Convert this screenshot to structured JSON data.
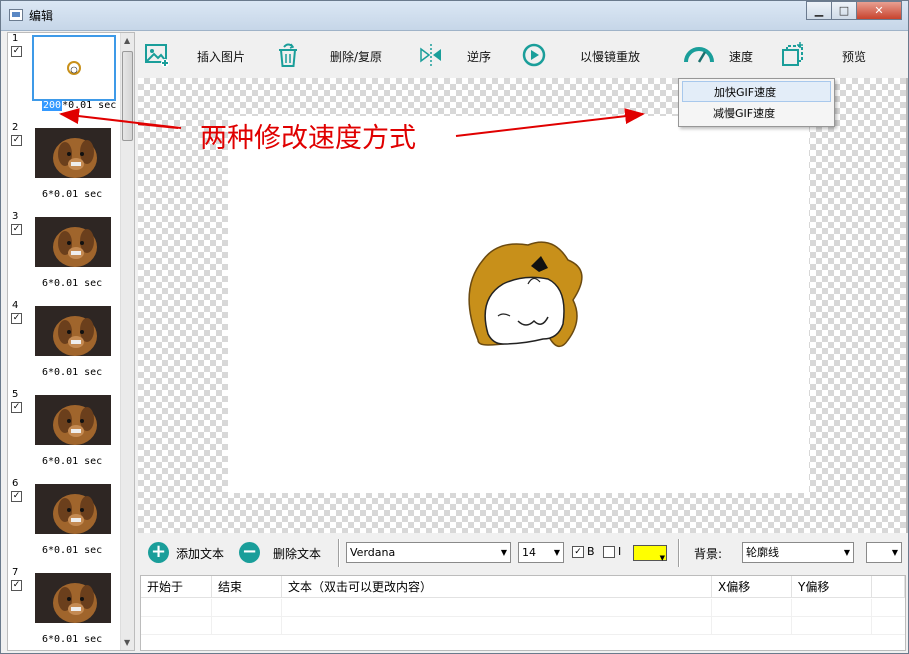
{
  "window": {
    "title": "编辑",
    "min_label": "▁",
    "max_label": "□",
    "close_label": "✕"
  },
  "frames": [
    {
      "index": "1",
      "checked": "✓",
      "delay_value": "200",
      "delay_suffix": "*0.01 sec"
    },
    {
      "index": "2",
      "checked": "✓",
      "delay_label": "6*0.01 sec"
    },
    {
      "index": "3",
      "checked": "✓",
      "delay_label": "6*0.01 sec"
    },
    {
      "index": "4",
      "checked": "✓",
      "delay_label": "6*0.01 sec"
    },
    {
      "index": "5",
      "checked": "✓",
      "delay_label": "6*0.01 sec"
    },
    {
      "index": "6",
      "checked": "✓",
      "delay_label": "6*0.01 sec"
    },
    {
      "index": "7",
      "checked": "✓",
      "delay_label": "6*0.01 sec"
    }
  ],
  "toolbar": {
    "insert_image": "插入图片",
    "delete_restore": "删除/复原",
    "reverse": "逆序",
    "slow_replay": "以慢镜重放",
    "speed": "速度",
    "preview": "预览"
  },
  "speed_menu": {
    "faster": "加快GIF速度",
    "slower": "减慢GIF速度"
  },
  "annotation": "两种修改速度方式",
  "textbar": {
    "add_text": "添加文本",
    "delete_text": "删除文本",
    "font": "Verdana",
    "size": "14",
    "bold_checked": "✓",
    "bold_label": "B",
    "italic_label": "I",
    "text_color": "#ffff00",
    "background_label": "背景:",
    "background_value": "轮廓线"
  },
  "table": {
    "columns": [
      "开始于",
      "结束",
      "文本（双击可以更改内容）",
      "X偏移",
      "Y偏移"
    ]
  },
  "colors": {
    "accent_red": "#e00000",
    "teal_icon": "#1a9e9a",
    "selection_blue": "#3e9ae8"
  }
}
